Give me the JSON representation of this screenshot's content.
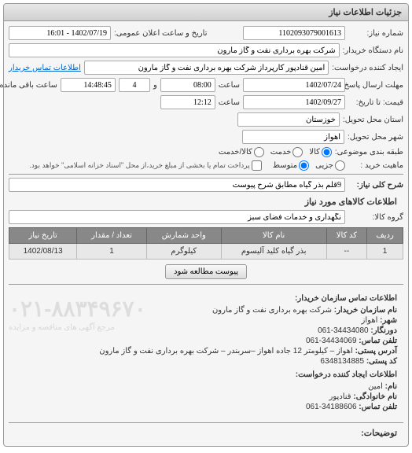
{
  "panel": {
    "title": "جزئیات اطلاعات نیاز"
  },
  "fields": {
    "need_number_label": "شماره نیاز:",
    "need_number": "1102093079001613",
    "announce_label": "تاریخ و ساعت اعلان عمومی:",
    "announce_value": "1402/07/19 - 16:01",
    "buyer_device_label": "نام دستگاه خریدار:",
    "buyer_device": "شرکت بهره برداری نفت و گاز مارون",
    "request_creator_label": "ایجاد کننده درخواست:",
    "request_creator": "امین قنادپور کارپرداز شرکت بهره برداری نفت و گاز مارون",
    "contact_link": "اطلاعات تماس خریدار",
    "deadline_label": "مهلت ارسال پاسخ: تا تاریخ:",
    "deadline_date": "1402/07/24",
    "time_label": "ساعت",
    "deadline_time": "08:00",
    "and_label": "و",
    "remaining_days": "4",
    "remaining_time": "14:48:45",
    "remaining_label": "ساعت باقی مانده",
    "price_until_label": "قیمت: تا تاریخ:",
    "price_date": "1402/09/27",
    "price_time": "12:12",
    "province_label": "استان محل تحویل:",
    "province": "خوزستان",
    "city_label": "شهر محل تحویل:",
    "city": "اهواز",
    "subject_class_label": "طبقه بندی موضوعی:",
    "subject_kala": "کالا",
    "subject_khadamat": "خدمت",
    "subject_both": "کالا/خدمت",
    "buy_type_label": "ماهیت خرید :",
    "buy_type_small": "جزیی",
    "buy_type_medium": "متوسط",
    "payment_note": "پرداخت تمام یا بخشی از مبلغ خرید،از محل \"اسناد خزانه اسلامی\" خواهد بود.",
    "general_desc_label": "شرح کلی نیاز:",
    "general_desc": "9قلم بذر گیاه مطابق شرح پیوست",
    "goods_section_title": "اطلاعات کالاهای مورد نیاز",
    "goods_group_label": "گروه کالا:",
    "goods_group": "نگهداری و خدمات فضای سبز",
    "attachment_btn": "پیوست مطالعه شود"
  },
  "table": {
    "headers": {
      "row": "ردیف",
      "code": "کد کالا",
      "name": "نام کالا",
      "unit": "واحد شمارش",
      "qty": "تعداد / مقدار",
      "date": "تاریخ نیاز"
    },
    "rows": [
      {
        "row": "1",
        "code": "--",
        "name": "بذر گیاه کلید آلیسوم",
        "unit": "کیلوگرم",
        "qty": "1",
        "date": "1402/08/13"
      }
    ]
  },
  "contact": {
    "section_title": "اطلاعات تماس سازمان خریدار:",
    "org_name_label": "نام سازمان خریدار:",
    "org_name": "شرکت بهره برداری نفت و گاز مارون",
    "city_label": "شهر:",
    "city": "اهواز",
    "dorn_label": "دورنگار:",
    "dorn": "34434080-061",
    "phone_label": "تلفن تماس:",
    "phone": "34434069-061",
    "address_label": "آدرس پستی:",
    "address": "اهواز – کیلومتر 12 جاده اهواز –سربندر – شرکت بهره برداری نفت و گاز مارون",
    "postal_label": "کد پستی:",
    "postal": "6348134885",
    "creator_section_title": "اطلاعات ایجاد کننده درخواست:",
    "first_name_label": "نام:",
    "first_name": "امین",
    "last_name_label": "نام خانوادگی:",
    "last_name": "قنادپور",
    "creator_phone_label": "تلفن تماس:",
    "creator_phone": "34188606-061",
    "watermark": "۰۲۱-۸۸۳۴۹۶۷۰",
    "watermark_sub": "مرجع آگهی های مناقصه و مزایده"
  },
  "explain_label": "توضیحات:"
}
